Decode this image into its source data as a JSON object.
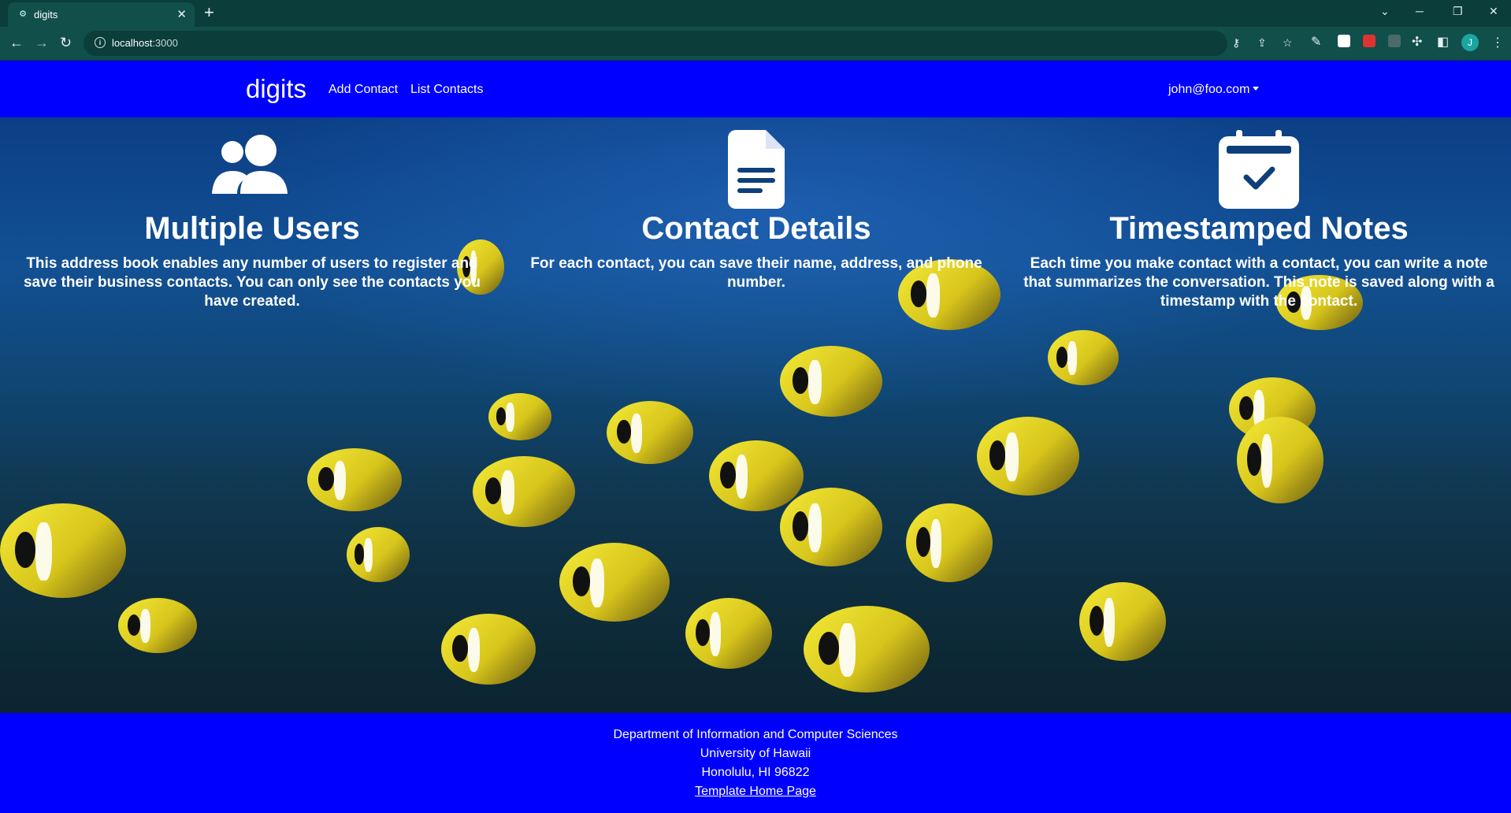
{
  "browser": {
    "tab_title": "digits",
    "url_host": "localhost",
    "url_port": ":3000",
    "profile_initial": "J"
  },
  "navbar": {
    "brand": "digits",
    "links": [
      "Add Contact",
      "List Contacts"
    ],
    "user": "john@foo.com"
  },
  "features": [
    {
      "icon": "users-icon",
      "title": "Multiple Users",
      "description": "This address book enables any number of users to register and save their business contacts. You can only see the contacts you have created."
    },
    {
      "icon": "file-document-icon",
      "title": "Contact Details",
      "description": "For each contact, you can save their name, address, and phone number."
    },
    {
      "icon": "calendar-check-icon",
      "title": "Timestamped Notes",
      "description": "Each time you make contact with a contact, you can write a note that summarizes the conversation. This note is saved along with a timestamp with the contact."
    }
  ],
  "footer": {
    "lines": [
      "Department of Information and Computer Sciences",
      "University of Hawaii",
      "Honolulu, HI 96822"
    ],
    "link": "Template Home Page"
  },
  "colors": {
    "brand_blue": "#0000ff",
    "chrome": "#114f4b"
  }
}
